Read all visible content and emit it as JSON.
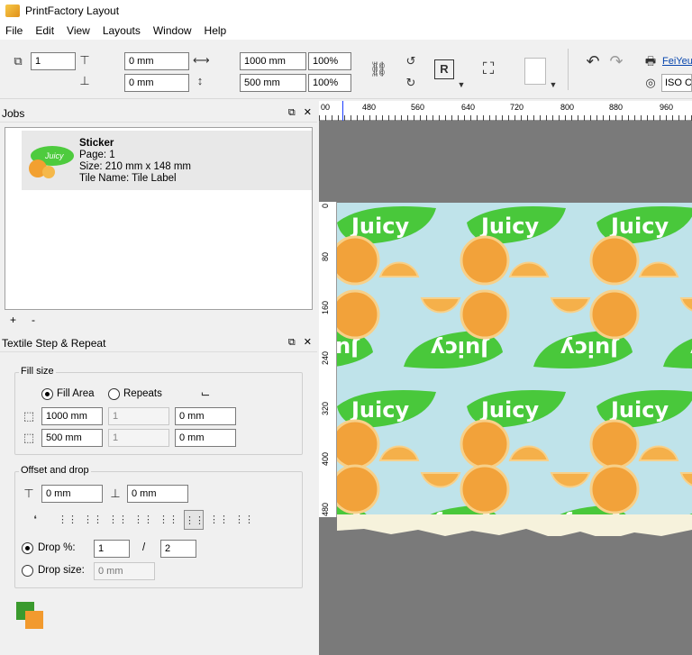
{
  "window": {
    "title": "PrintFactory Layout"
  },
  "menu": [
    "File",
    "Edit",
    "View",
    "Layouts",
    "Window",
    "Help"
  ],
  "toolbar": {
    "copies": "1",
    "offset_x": "0 mm",
    "offset_y": "0 mm",
    "width": "1000 mm",
    "height": "500 mm",
    "scale_x": "100%",
    "scale_y": "100%",
    "printer_link": "FeiYeun",
    "profile_label": "ISO Co"
  },
  "ruler_top": [
    "00",
    "480",
    "560",
    "640",
    "720",
    "800",
    "880",
    "960"
  ],
  "ruler_left": [
    "0",
    "80",
    "160",
    "240",
    "320",
    "400",
    "480"
  ],
  "jobs_panel": {
    "title": "Jobs",
    "job": {
      "name": "Sticker",
      "page": "Page: 1",
      "size": "Size: 210 mm x 148 mm",
      "tile": "Tile Name: Tile Label",
      "thumb_text": "Juicy"
    },
    "add_label": "+",
    "remove_label": "-"
  },
  "step_repeat_panel": {
    "title": "Textile Step & Repeat",
    "fill_size": {
      "legend": "Fill size",
      "fill_area_label": "Fill Area",
      "repeats_label": "Repeats",
      "width": "1000 mm",
      "width_repeats": "1",
      "width_gap": "0 mm",
      "height": "500 mm",
      "height_repeats": "1",
      "height_gap": "0 mm"
    },
    "offset_drop": {
      "legend": "Offset and drop",
      "offset_x": "0 mm",
      "offset_y": "0 mm",
      "drop_pct_label": "Drop %:",
      "drop_num": "1",
      "drop_sep": "/",
      "drop_den": "2",
      "drop_size_label": "Drop size:",
      "drop_size_placeholder": "0 mm"
    }
  },
  "pattern_text": "Juicy"
}
